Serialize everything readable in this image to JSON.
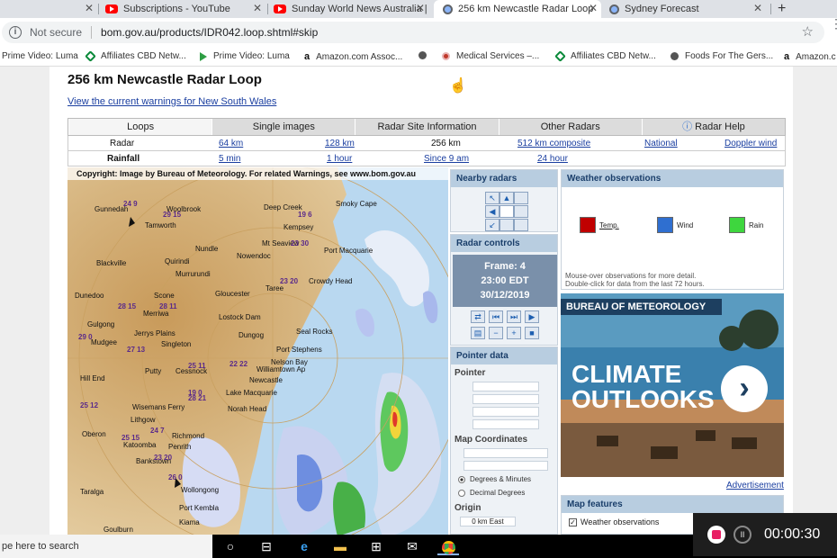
{
  "tabs": [
    {
      "label": "",
      "type": "blank"
    },
    {
      "label": "Subscriptions - YouTube",
      "type": "youtube"
    },
    {
      "label": "Sunday World News Australia |",
      "type": "youtube"
    },
    {
      "label": "256 km Newcastle Radar Loop",
      "type": "globe",
      "active": true
    },
    {
      "label": "Sydney Forecast",
      "type": "globe"
    }
  ],
  "omnibox": {
    "security": "Not secure",
    "url": "bom.gov.au/products/IDR042.loop.shtml#skip"
  },
  "bookmarks": [
    {
      "label": "Prime Video: Luma",
      "icon": "play-icon"
    },
    {
      "label": "Affiliates CBD Netw...",
      "icon": "diamond-icon"
    },
    {
      "label": "Prime Video: Luma",
      "icon": "play-icon"
    },
    {
      "label": "Amazon.com Assoc...",
      "icon": "amazon-icon"
    },
    {
      "label": "",
      "icon": "globe-icon"
    },
    {
      "label": "Medical Services –...",
      "icon": "medical-icon"
    },
    {
      "label": "Affiliates CBD Netw...",
      "icon": "diamond-icon"
    },
    {
      "label": "Foods For The Gers...",
      "icon": "globe-icon"
    },
    {
      "label": "Amazon.c",
      "icon": "amazon-icon"
    }
  ],
  "page": {
    "title": "256 km Newcastle Radar Loop",
    "warnings_link": "View the current warnings for New South Wales"
  },
  "nav_tabs": [
    "Loops",
    "Single images",
    "Radar Site Information",
    "Other Radars",
    "Radar Help"
  ],
  "radar_row": {
    "label": "Radar",
    "options": [
      "64 km",
      "128 km",
      "256 km",
      "512 km composite",
      "National",
      "Doppler wind"
    ]
  },
  "rainfall_row": {
    "label": "Rainfall",
    "options": [
      "5 min",
      "1 hour",
      "Since 9 am",
      "24 hour"
    ]
  },
  "radar_image": {
    "copyright": "Copyright: Image by Bureau of Meteorology. For related Warnings, see www.bom.gov.au",
    "towns": [
      "Gunnedah",
      "Woolbrook",
      "Tamworth",
      "Deep Creek",
      "Kempsey",
      "Smoky Cape",
      "Nundle",
      "Mt Seaview",
      "Port Macquarie",
      "Nowendoc",
      "Blackville",
      "Quirindi",
      "Murrurundi",
      "Taree",
      "Crowdy Head",
      "Dunedoo",
      "Scone",
      "Gloucester",
      "Gulgong",
      "Merriwa",
      "Lostock Dam",
      "Seal Rocks",
      "Mudgee",
      "Jerrys Plains",
      "Singleton",
      "Dungog",
      "Port Stephens",
      "Nelson Bay",
      "Williamtown Ap",
      "Putty",
      "Cessnock",
      "Newcastle",
      "Lake Macquarie",
      "Hill End",
      "Wisemans Ferry",
      "Norah Head",
      "Lithgow",
      "Oberon",
      "Katoomba",
      "Richmond",
      "Penrith",
      "Bankstown",
      "Taralga",
      "Wollongong",
      "Port Kembla",
      "Kiama",
      "Goulburn"
    ],
    "observations": [
      "24 9",
      "29 15",
      "19 6",
      "23 30",
      "23 20",
      "28 15",
      "28 11",
      "29 0",
      "27 13",
      "22 22",
      "25 11",
      "25 12",
      "25 15",
      "24 7",
      "23 20",
      "19 0",
      "28 21",
      "26 0"
    ]
  },
  "nearby_radars": {
    "title": "Nearby radars"
  },
  "radar_controls": {
    "title": "Radar controls",
    "frame": "Frame: 4",
    "time": "23:00 EDT",
    "date": "30/12/2019"
  },
  "pointer_data": {
    "title": "Pointer data",
    "pointer_label": "Pointer",
    "map_coords_label": "Map Coordinates",
    "format_options": [
      "Degrees & Minutes",
      "Decimal Degrees"
    ],
    "origin_label": "Origin",
    "origin_value": "0 km East"
  },
  "weather_obs": {
    "title": "Weather observations",
    "legend": [
      {
        "label": "Temp.",
        "color": "#c00000"
      },
      {
        "label": "Wind",
        "color": "#2f6fd0"
      },
      {
        "label": "Rain",
        "color": "#3ed63e"
      }
    ],
    "note1": "Mouse-over observations for more detail.",
    "note2": "Double-click for data from the last 72 hours."
  },
  "ad": {
    "brand": "BUREAU OF METEOROLOGY",
    "line1": "CLIMATE",
    "line2": "OUTLOOKS",
    "link": "Advertisement"
  },
  "map_features": {
    "title": "Map features",
    "items": [
      "Weather observations"
    ]
  },
  "taskbar": {
    "search": "pe here to search"
  },
  "recorder": {
    "time": "00:00:30"
  }
}
